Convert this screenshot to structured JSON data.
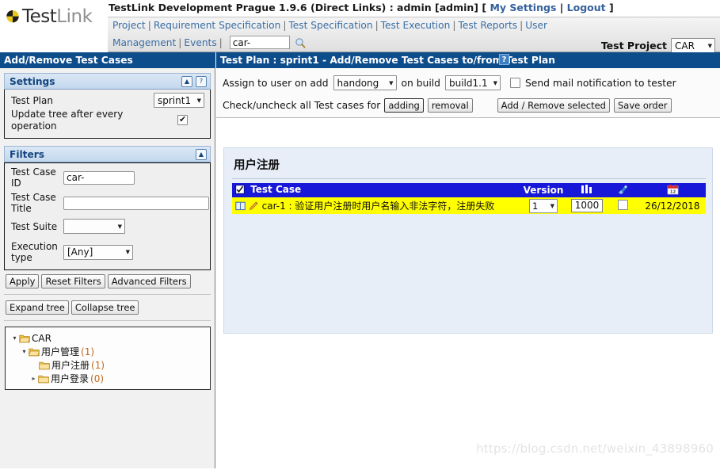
{
  "header": {
    "logo_text_1": "Test",
    "logo_text_2": "Link",
    "logo_icon": "testlink-shield-icon",
    "title_main": "TestLink Development Prague 1.9.6 (Direct Links) : admin [admin] [ ",
    "title_my_settings": "My Settings",
    "title_sep": " | ",
    "title_logout": "Logout",
    "title_close": " ]"
  },
  "nav": {
    "row1": [
      {
        "label": "Project"
      },
      {
        "label": "Requirement Specification"
      },
      {
        "label": "Test Specification"
      },
      {
        "label": "Test Execution"
      },
      {
        "label": "Test Reports"
      },
      {
        "label": "User"
      }
    ],
    "row2": [
      {
        "label": "Management"
      },
      {
        "label": "Events"
      }
    ],
    "separator": "|",
    "search_value": "car-",
    "search_placeholder": "",
    "search_icon": "magnifier-icon",
    "project_label": "Test Project",
    "project_value": "CAR",
    "project_options": [
      "CAR"
    ]
  },
  "left": {
    "panel_title": "Add/Remove Test Cases",
    "settings": {
      "title": "Settings",
      "collapse_icon": "chevron-up-icon",
      "help_icon": "question-mark-icon",
      "help_label": "?",
      "collapse_label": "▲",
      "test_plan_label": "Test Plan",
      "test_plan_value": "sprint1",
      "test_plan_options": [
        "sprint1"
      ],
      "update_tree_label": "Update tree after every operation",
      "update_tree_checked": true
    },
    "filters": {
      "title": "Filters",
      "collapse_label": "▲",
      "tc_id_label": "Test Case ID",
      "tc_id_value": "car-",
      "tc_title_label": "Test Case Title",
      "tc_title_value": "",
      "test_suite_label": "Test Suite",
      "test_suite_value": "",
      "test_suite_options": [
        ""
      ],
      "exec_type_label": "Execution type",
      "exec_type_value": "[Any]",
      "exec_type_options": [
        "[Any]"
      ],
      "apply_label": "Apply",
      "reset_label": "Reset Filters",
      "advanced_label": "Advanced Filters"
    },
    "tree_buttons": {
      "expand_label": "Expand tree",
      "collapse_label": "Collapse tree"
    },
    "tree": [
      {
        "label": "CAR",
        "count": "",
        "depth": 0,
        "arrow": "open",
        "icon": "folder-open-icon"
      },
      {
        "label": "用户管理",
        "count": "(1)",
        "depth": 1,
        "arrow": "open",
        "icon": "folder-open-icon"
      },
      {
        "label": "用户注册",
        "count": "(1)",
        "depth": 2,
        "arrow": "none",
        "icon": "folder-icon"
      },
      {
        "label": "用户登录",
        "count": "(0)",
        "depth": 2,
        "arrow": "closed",
        "icon": "folder-icon"
      }
    ]
  },
  "right": {
    "panel_title": "Test Plan : sprint1 - Add/Remove Test Cases to/from Test Plan",
    "help_icon": "question-mark-icon",
    "help_label": "?",
    "toolbar": {
      "assign_label": "Assign to user on add",
      "assign_value": "handong",
      "assign_options": [
        "handong"
      ],
      "build_label": "on build",
      "build_value": "build1.1",
      "build_options": [
        "build1.1"
      ],
      "mail_checked": false,
      "mail_label": "Send mail notification to tester",
      "check_all_label": "Check/uncheck all Test cases for",
      "adding_label": "adding",
      "removal_label": "removal",
      "add_remove_label": "Add / Remove selected",
      "save_order_label": "Save order"
    },
    "suite_heading": "用户注册",
    "table": {
      "header_checkbox_checked": true,
      "columns": [
        {
          "label": "Test Case",
          "icon": ""
        },
        {
          "label": "Version",
          "icon": ""
        },
        {
          "label": "",
          "icon": "priority-bars-icon"
        },
        {
          "label": "",
          "icon": "tester-plug-icon"
        },
        {
          "label": "",
          "icon": "calendar-icon"
        }
      ],
      "rows": [
        {
          "doc_icon": "document-icon",
          "edit_icon": "pencil-icon",
          "name": "car-1 : 验证用户注册时用户名输入非法字符，注册失败",
          "version": "1",
          "version_options": [
            "1"
          ],
          "priority": "1000",
          "tester_checked": false,
          "date": "26/12/2018"
        }
      ]
    },
    "watermark": "https://blog.csdn.net/weixin_43898960"
  },
  "colors": {
    "header_blue": "#0e4d8c",
    "table_header_blue": "#1818d8",
    "row_yellow": "#ffff00",
    "link_blue": "#3a6ea5",
    "card_blue": "#e8eef7",
    "logo_yellow": "#e8c81e"
  }
}
